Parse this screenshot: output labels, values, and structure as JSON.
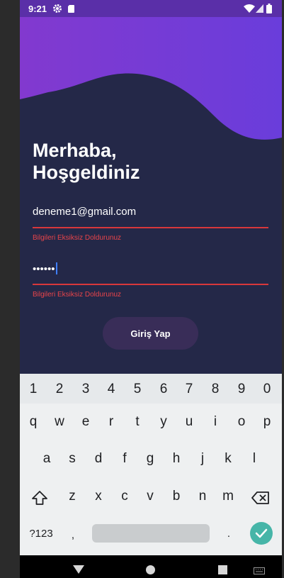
{
  "status_bar": {
    "time": "9:21"
  },
  "screen": {
    "greeting_line1": "Merhaba,",
    "greeting_line2": "Hoşgeldiniz",
    "email": {
      "value": "deneme1@gmail.com",
      "error": "Bilgileri Eksiksiz Doldurunuz"
    },
    "password": {
      "value": "••••••",
      "error": "Bilgileri Eksiksiz Doldurunuz"
    },
    "login_button": "Giriş Yap"
  },
  "keyboard": {
    "numbers": [
      "1",
      "2",
      "3",
      "4",
      "5",
      "6",
      "7",
      "8",
      "9",
      "0"
    ],
    "row1": [
      "q",
      "w",
      "e",
      "r",
      "t",
      "y",
      "u",
      "i",
      "o",
      "p"
    ],
    "row2": [
      "a",
      "s",
      "d",
      "f",
      "g",
      "h",
      "j",
      "k",
      "l"
    ],
    "row3": [
      "z",
      "x",
      "c",
      "v",
      "b",
      "n",
      "m"
    ],
    "symbols_key": "?123",
    "comma_key": ",",
    "period_key": "."
  },
  "colors": {
    "background": "#242848",
    "accent_purple": "#7a3fd0",
    "error": "#e8444a",
    "button": "#392d58",
    "enter_key": "#46b5a8"
  },
  "icons": [
    "settings-icon",
    "sd-card-icon",
    "wifi-icon",
    "signal-icon",
    "battery-icon",
    "shift-icon",
    "backspace-icon",
    "check-icon",
    "nav-back-icon",
    "nav-home-icon",
    "nav-recents-icon",
    "keyboard-switch-icon"
  ]
}
